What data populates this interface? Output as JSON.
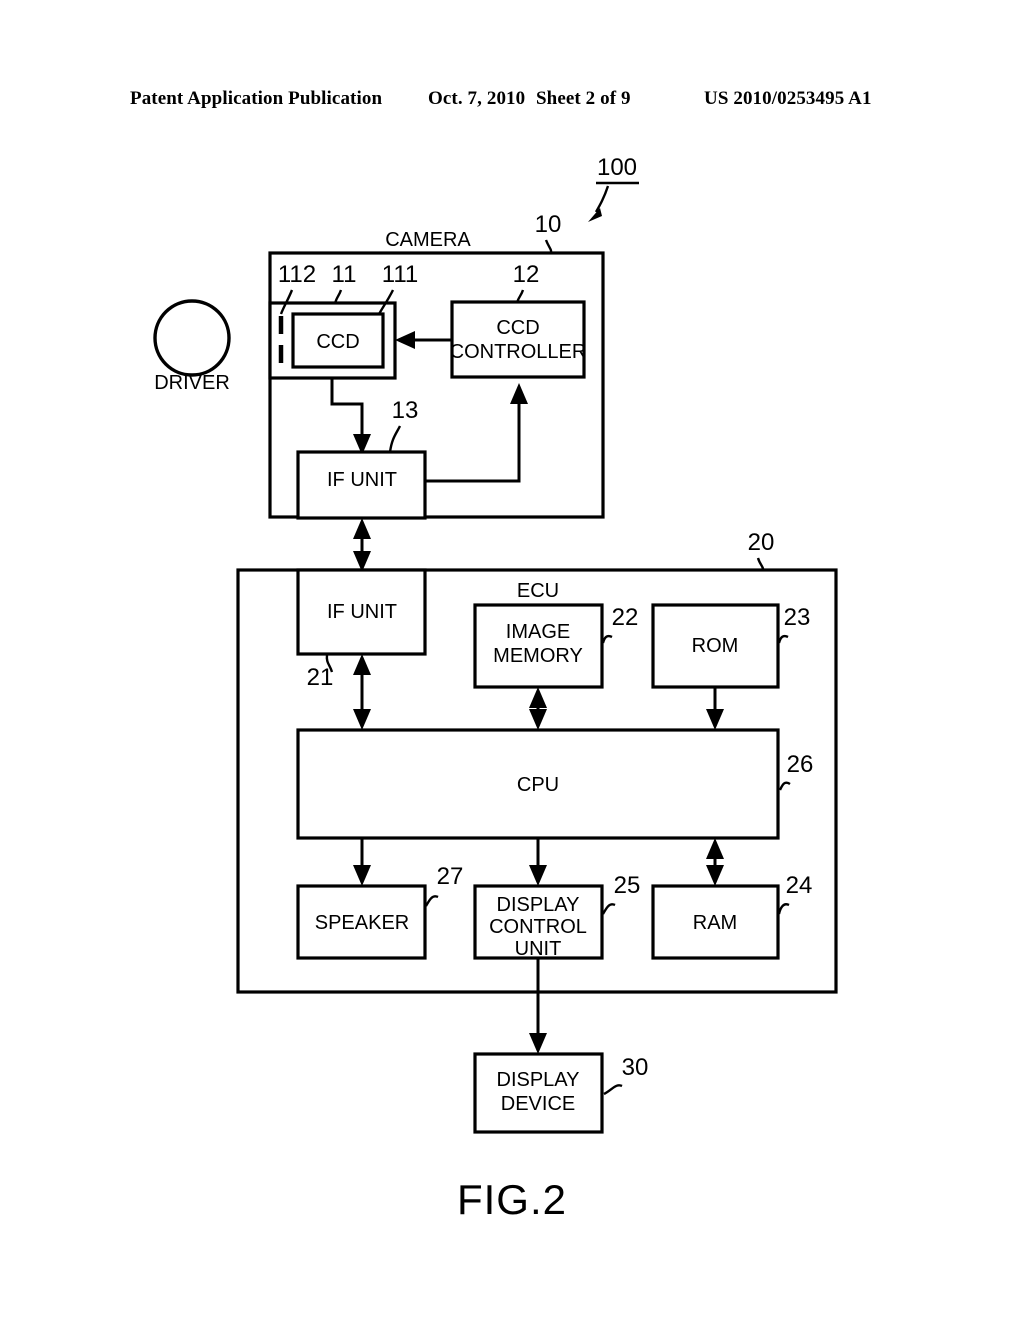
{
  "header": {
    "title": "Patent Application Publication",
    "date": "Oct. 7, 2010",
    "sheet": "Sheet 2 of 9",
    "patent_number": "US 2010/0253495 A1"
  },
  "figure": {
    "caption": "FIG.2",
    "system_ref": "100"
  },
  "camera": {
    "title": "CAMERA",
    "ref": "10",
    "lens_ref": "112",
    "optics_ref": "11",
    "ccd": {
      "label": "CCD",
      "ref": "111"
    },
    "ccd_controller": {
      "label_line1": "CCD",
      "label_line2": "CONTROLLER",
      "ref": "12"
    },
    "if_unit": {
      "label": "IF UNIT",
      "ref": "13"
    }
  },
  "driver": {
    "label": "DRIVER"
  },
  "ecu": {
    "title": "ECU",
    "ref": "20",
    "if_unit": {
      "label": "IF UNIT",
      "ref": "21"
    },
    "image_memory": {
      "label_line1": "IMAGE",
      "label_line2": "MEMORY",
      "ref": "22"
    },
    "rom": {
      "label": "ROM",
      "ref": "23"
    },
    "cpu": {
      "label": "CPU",
      "ref": "26"
    },
    "speaker": {
      "label": "SPEAKER",
      "ref": "27"
    },
    "display_control_unit": {
      "label_line1": "DISPLAY",
      "label_line2": "CONTROL",
      "label_line3": "UNIT",
      "ref": "25"
    },
    "ram": {
      "label": "RAM",
      "ref": "24"
    }
  },
  "display_device": {
    "label_line1": "DISPLAY",
    "label_line2": "DEVICE",
    "ref": "30"
  },
  "colors": {
    "ink": "#000000",
    "paper": "#ffffff"
  }
}
